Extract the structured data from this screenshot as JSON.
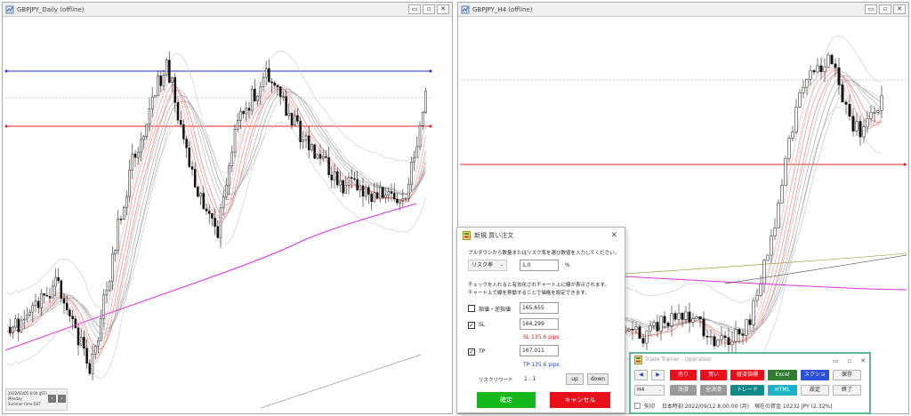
{
  "left_window": {
    "title": "GBPJPY_Daily (offline)",
    "info_lines": [
      "2022/03/05 8:00 (JST)",
      "Monday",
      "Summer time      DST"
    ]
  },
  "right_window": {
    "title": "GBPJPY_H4 (offline)"
  },
  "window_buttons": {
    "minimize": "▭",
    "restore": "▫",
    "close": "✕"
  },
  "order_dialog": {
    "title": "新規 買い注文",
    "close": "✕",
    "instruction": "プルダウンから数量またはリスク率を選び数値を入力してください。",
    "mode_select": "リスク率",
    "mode_value": "1.0",
    "mode_unit": "%",
    "note_line1": "チェックを入れると有効化されチャート上に線が表示されます。",
    "note_line2": "チャート上で線を移動することで価格を設定できます。",
    "limit_label": "指値・逆指値",
    "limit_value": "165.655",
    "limit_checked": false,
    "sl_label": "SL",
    "sl_value": "164.299",
    "sl_checked": true,
    "sl_pips": "SL 135.6 pips",
    "tp_label": "TP",
    "tp_value": "167.011",
    "tp_checked": true,
    "tp_pips": "TP 135.6 pips",
    "risk_reward_label": "リスクリワード",
    "risk_reward_value": "1 : 1",
    "up": "up",
    "down": "down",
    "confirm": "確定",
    "cancel": "キャンセル"
  },
  "trade_trainer": {
    "title": "Trade Trainer - Operation",
    "prev": "◀",
    "next": "▶",
    "sell": "売り",
    "buy": "買い",
    "indicators": "経済指標",
    "excel": "Excel",
    "screenshot": "スクショ",
    "save": "保存",
    "timeframe": "H4",
    "settle": "決済",
    "settle_all": "全決済",
    "trade": "トレード",
    "html": "HTML",
    "settings": "設定",
    "exit": "終了",
    "arrow_label": "矢印",
    "status": "日本時刻 2022/09/12 8:00:00 (月)　現在の資金 10232 JPY (2.32%)"
  },
  "colors": {
    "sell": "#e8101a",
    "buy": "#e8101a",
    "indicators": "#e8101a",
    "excel": "#2e7d32",
    "screenshot": "#2b4fd8",
    "settle": "#9a9a9a",
    "trade": "#138a8a",
    "html": "#1cb3c8",
    "confirm": "#13b81a",
    "cancel": "#e8101a",
    "nav": "#1a3fd0"
  }
}
